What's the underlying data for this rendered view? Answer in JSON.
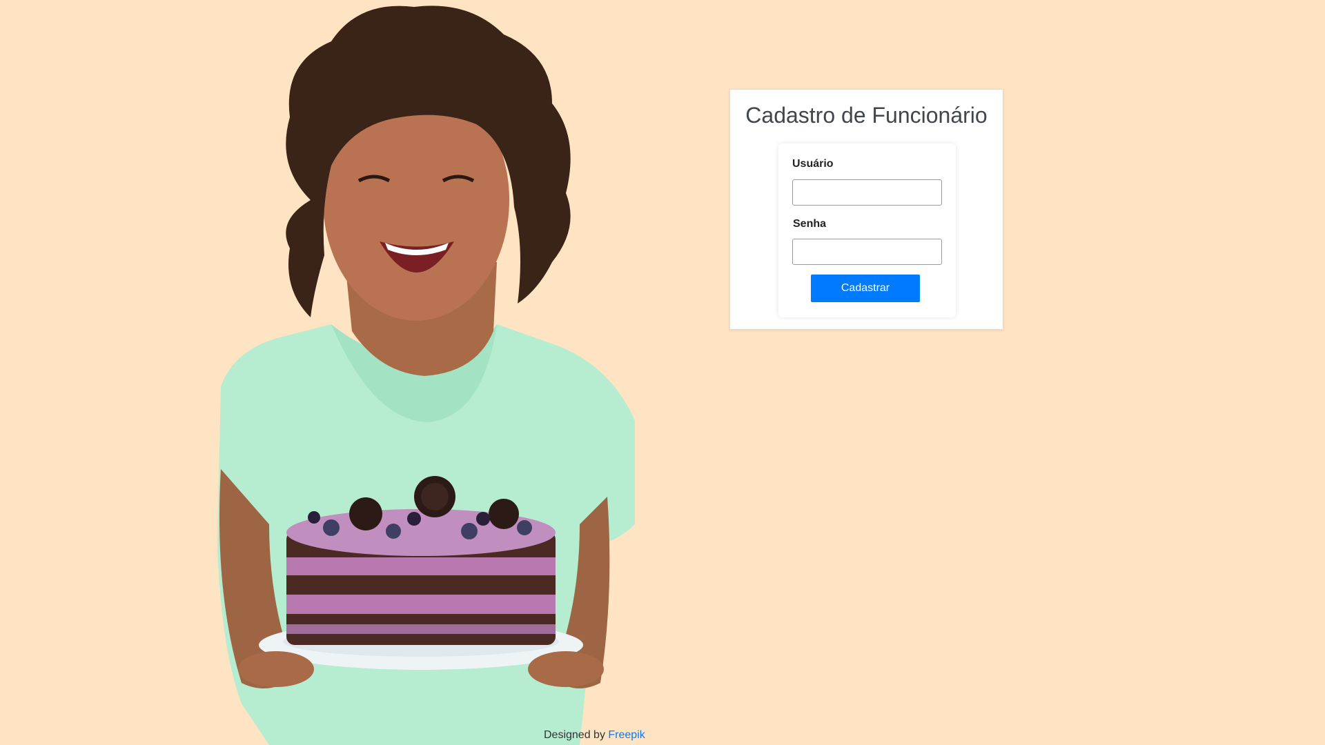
{
  "form": {
    "title": "Cadastro de Funcionário",
    "username_label": "Usuário",
    "username_value": "",
    "password_label": "Senha",
    "password_value": "",
    "submit_label": "Cadastrar"
  },
  "credit": {
    "prefix": "Designed by",
    "link_text": "Freepik"
  },
  "colors": {
    "background": "#ffe4c4",
    "accent": "#007bff",
    "shirt": "#b6ecd0",
    "cake_chocolate": "#4a2a22",
    "cake_cream": "#b779b0"
  },
  "illustration": {
    "subject": "smiling woman holding a layered chocolate berry cake"
  }
}
